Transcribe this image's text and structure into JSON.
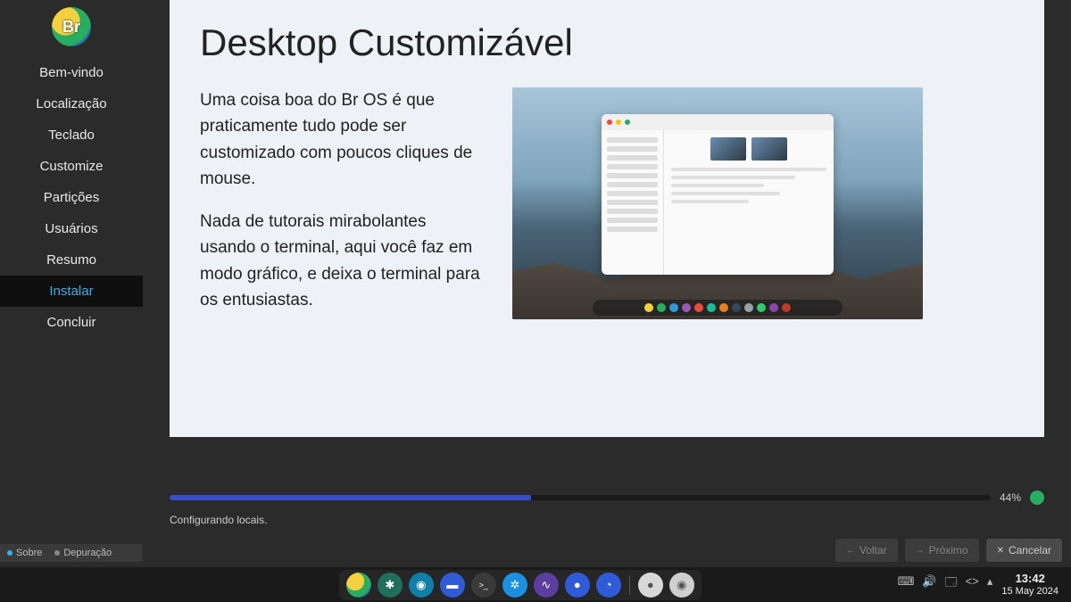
{
  "sidebar": {
    "logo_text": "Br",
    "steps": [
      "Bem-vindo",
      "Localização",
      "Teclado",
      "Customize",
      "Partições",
      "Usuários",
      "Resumo",
      "Instalar",
      "Concluir"
    ],
    "active_index": 7,
    "footer": {
      "about": "Sobre",
      "debug": "Depuração"
    }
  },
  "slide": {
    "title": "Desktop Customizável",
    "p1": "Uma coisa boa do Br OS é que praticamente tudo pode ser customizado com poucos cliques de mouse.",
    "p2": "Nada de tutorais mirabolantes usando o terminal, aqui você faz em modo gráfico, e deixa o terminal para os entusiastas."
  },
  "progress": {
    "percent": 44,
    "percent_label": "44%",
    "status": "Configurando locais."
  },
  "buttons": {
    "back": "Voltar",
    "next": "Próximo",
    "cancel": "Cancelar"
  },
  "taskbar": {
    "clock_time": "13:42",
    "clock_date": "15 May 2024",
    "dock_icons": [
      {
        "name": "bros-logo",
        "bg": "radial-gradient(circle at 35% 35%,#f4d03f 0 40%,#27ae60 40% 70%,#2874a6 70% 100%)",
        "glyph": ""
      },
      {
        "name": "snowflake",
        "bg": "#1f6f5c",
        "glyph": "✱"
      },
      {
        "name": "browser",
        "bg": "#0e7fa8",
        "glyph": "◉"
      },
      {
        "name": "files",
        "bg": "#2f5bd8",
        "glyph": "▬"
      },
      {
        "name": "terminal",
        "bg": "#3a3a3a",
        "glyph": ">_"
      },
      {
        "name": "settings",
        "bg": "#1d8fe1",
        "glyph": "✲"
      },
      {
        "name": "wave",
        "bg": "#5b3fa0",
        "glyph": "∿"
      },
      {
        "name": "chat",
        "bg": "#2f5bd8",
        "glyph": "●"
      },
      {
        "name": "shield",
        "bg": "#2f5bd8",
        "glyph": "◔"
      },
      {
        "name": "record",
        "bg": "#d8d8d8",
        "glyph": "●"
      },
      {
        "name": "disc",
        "bg": "#cfcfcf",
        "glyph": "◉"
      }
    ],
    "tray_icons": [
      "⌨",
      "🔊",
      "🗔",
      "<>",
      "▴"
    ]
  }
}
